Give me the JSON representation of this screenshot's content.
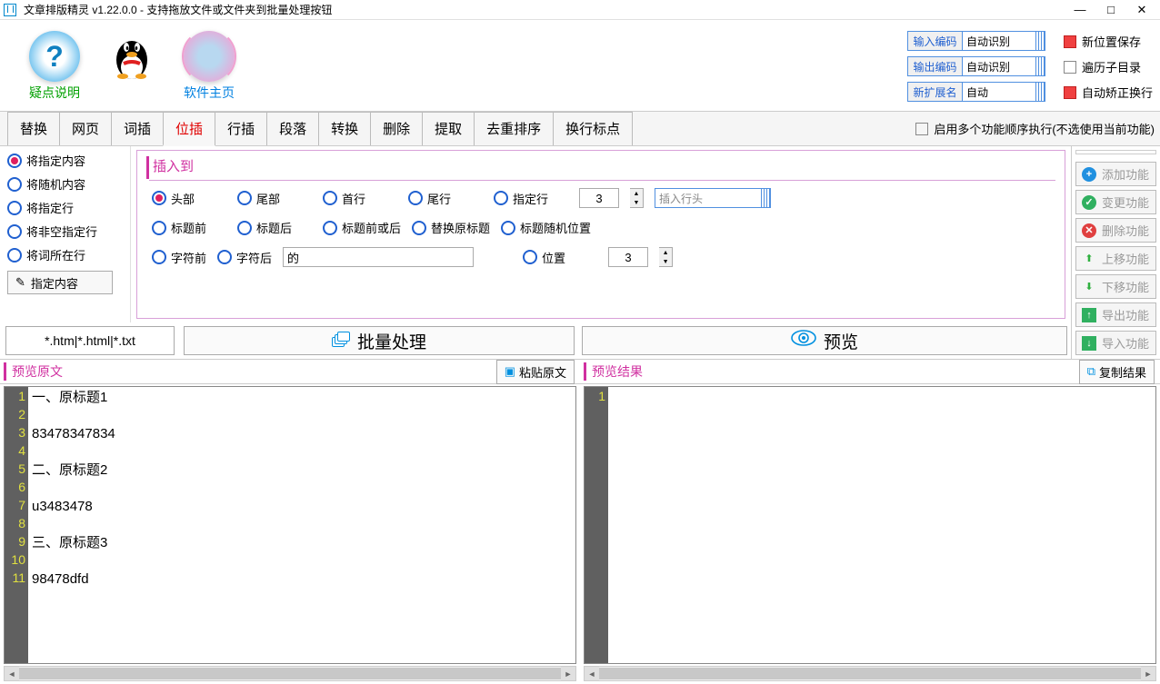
{
  "window": {
    "title": "文章排版精灵 v1.22.0.0 - 支持拖放文件或文件夹到批量处理按钮"
  },
  "header": {
    "help_label": "疑点说明",
    "home_label": "软件主页",
    "encoding": {
      "in_label": "输入编码",
      "in_value": "自动识别",
      "out_label": "输出编码",
      "out_value": "自动识别",
      "ext_label": "新扩展名",
      "ext_value": "自动"
    },
    "checks": {
      "new_pos_save": "新位置保存",
      "traverse_sub": "遍历子目录",
      "auto_fix_wrap": "自动矫正换行"
    }
  },
  "tabs": [
    "替换",
    "网页",
    "词插",
    "位插",
    "行插",
    "段落",
    "转换",
    "删除",
    "提取",
    "去重排序",
    "换行标点"
  ],
  "tabs_right_label": "启用多个功能顺序执行(不选使用当前功能)",
  "left_radios": [
    "将指定内容",
    "将随机内容",
    "将指定行",
    "将非空指定行",
    "将词所在行"
  ],
  "spec_button": "指定内容",
  "insert": {
    "section": "插入到",
    "row1": [
      "头部",
      "尾部",
      "首行",
      "尾行",
      "指定行"
    ],
    "row1_num": "3",
    "row1_placeholder": "插入行头",
    "row2": [
      "标题前",
      "标题后",
      "标题前或后",
      "替换原标题",
      "标题随机位置"
    ],
    "row3": [
      "字符前",
      "字符后"
    ],
    "row3_text": "的",
    "row3_pos": "位置",
    "row3_num": "3"
  },
  "side_buttons": {
    "add": "添加功能",
    "change": "变更功能",
    "delete": "删除功能",
    "up": "上移功能",
    "down": "下移功能",
    "export": "导出功能",
    "import": "导入功能"
  },
  "ext_filter": "*.htm|*.html|*.txt",
  "batch_label": "批量处理",
  "preview_label": "预览",
  "preview_src_title": "预览原文",
  "paste_src": "粘贴原文",
  "preview_res_title": "预览结果",
  "copy_res": "复制结果",
  "source_lines": [
    "一、原标题1",
    "",
    "83478347834",
    "",
    "二、原标题2",
    "",
    "u3483478",
    "",
    "三、原标题3",
    "",
    "98478dfd"
  ]
}
